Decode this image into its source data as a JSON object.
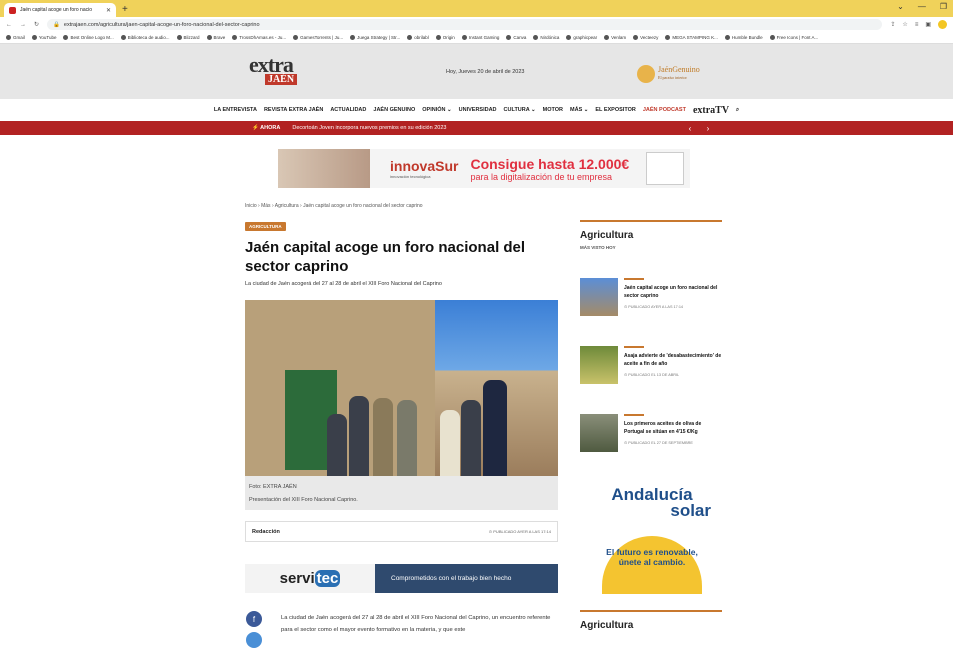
{
  "browser": {
    "tab_title": "Jaén capital acoge un foro nacio",
    "url": "extrajaen.com/agricultura/jaen-capital-acoge-un-foro-nacional-del-sector-caprino",
    "bookmarks": [
      "Gmail",
      "YouTube",
      "Best Online Logo M...",
      "Biblioteca de audio...",
      "Blizzard",
      "Brave",
      "TrossDhAmas.es - Ju...",
      "GamesTorrents | Ju...",
      "Juega Strategy | Str...",
      "obrilabl",
      "Origin",
      "Instant Gaming",
      "Canva",
      "Nirdónica",
      "graphicpear",
      "Venlam",
      "Vecteezy",
      "MEGA STAMPING K...",
      "Humble Bundle",
      "Free Icons | Font A..."
    ]
  },
  "header": {
    "logo_extra": "extra",
    "logo_jaen": "JAÉN",
    "date": "Hoy, Jueves 20 de abril de 2023",
    "partner_name": "JaénGenuino",
    "partner_tagline": "El paraíso interior"
  },
  "nav": {
    "items": [
      "LA ENTREVISTA",
      "REVISTA EXTRA JAÉN",
      "ACTUALIDAD",
      "JAÉN GENUINO",
      "OPINIÓN ⌄",
      "UNIVERSIDAD",
      "CULTURA ⌄",
      "MOTOR",
      "MÁS ⌄",
      "EL EXPOSITOR"
    ],
    "podcast": "JAÉN PODCAST",
    "tv": "extraTV"
  },
  "ticker": {
    "label": "⚡ AHORA",
    "text": "Decortoán Joven incorpora nuevos premios en su edición 2023"
  },
  "ad_banner": {
    "brand": "innovaSur",
    "brand_sub": "innovación tecnológica",
    "headline": "Consigue hasta 12.000€",
    "subline": "para la digitalización de tu empresa"
  },
  "article": {
    "breadcrumb": "Inicio  ›  Más  ›  Agricultura  ›  Jaén capital acoge un foro nacional del sector caprino",
    "category": "AGRICULTURA",
    "title": "Jaén capital acoge un foro nacional del sector caprino",
    "lede": "La ciudad de Jaén acogerá del 27 al 28 de abril el XIII Foro Nacional del Caprino",
    "photo_credit": "Foto: EXTRA JAÉN",
    "photo_caption": "Presentación del XIII Foro Nacional Caprino.",
    "author": "Redacción",
    "published": "⊙ PUBLICADO AYER A LAS 17:14",
    "body": "La ciudad de Jaén acogerá del 27 al 28 de abril el XIII Foro Nacional del Caprino, un encuentro referente para el sector como el mayor evento formativo en la materia, y que este"
  },
  "servitec": {
    "brand": "servi",
    "brand_tail": "tec",
    "slogan": "Comprometidos con el trabajo bien hecho"
  },
  "sidebar": {
    "section": "Agricultura",
    "sub": "MÁS VISTO HOY",
    "items": [
      {
        "title": "Jaén capital acoge un foro nacional del sector caprino",
        "date": "⊙ PUBLICADO AYER A LAS 17:14"
      },
      {
        "title": "Asaja advierte de 'desabastecimiento' de aceite a fin de año",
        "date": "⊙ PUBLICADO EL 13 DE ABRIL"
      },
      {
        "title": "Los primeros aceites de oliva de Portugal se sitúan en 4'15 €/Kg",
        "date": "⊙ PUBLICADO EL 27 DE SEPTIEMBRE"
      }
    ],
    "ad_line1": "Andalucía",
    "ad_line2": "solar",
    "ad_circle": "El futuro es renovable, únete al cambio.",
    "section2": "Agricultura"
  },
  "colors": {
    "accent": "#c8782f",
    "ticker": "#b22222",
    "brand_red": "#c0392b"
  }
}
